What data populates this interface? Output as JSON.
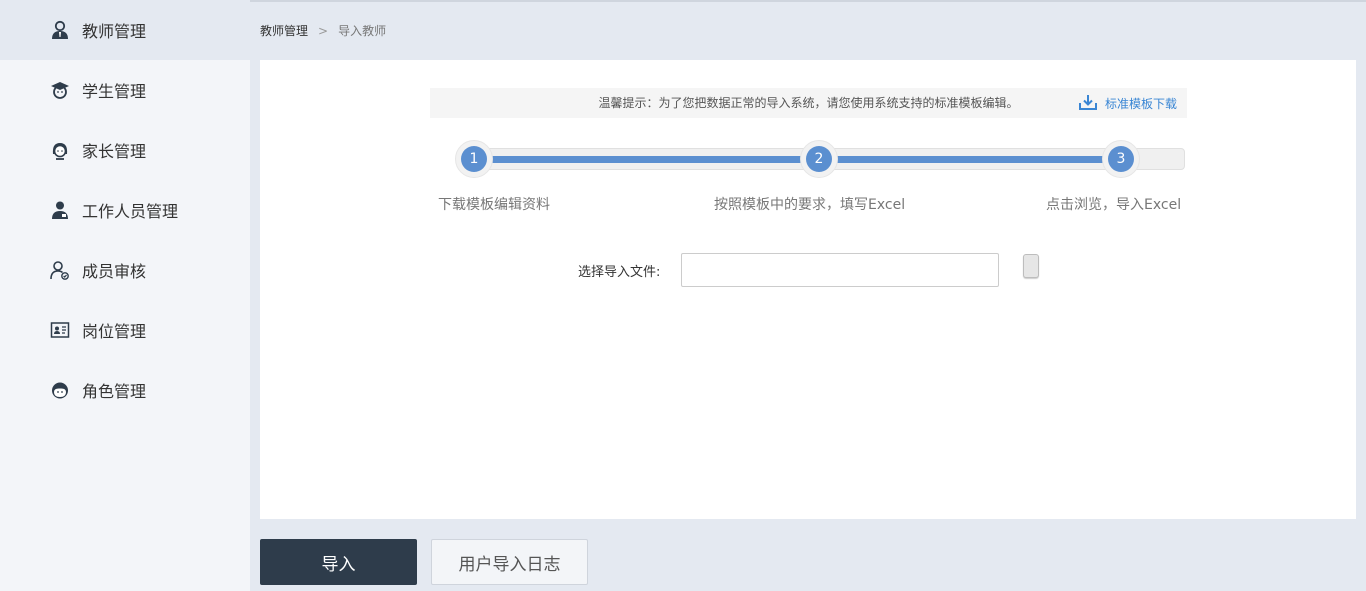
{
  "sidebar": {
    "items": [
      {
        "label": "教师管理",
        "icon": "teacher-icon",
        "active": true
      },
      {
        "label": "学生管理",
        "icon": "student-icon"
      },
      {
        "label": "家长管理",
        "icon": "parent-icon"
      },
      {
        "label": "工作人员管理",
        "icon": "staff-icon"
      },
      {
        "label": "成员审核",
        "icon": "member-review-icon"
      },
      {
        "label": "岗位管理",
        "icon": "position-icon"
      },
      {
        "label": "角色管理",
        "icon": "role-icon"
      }
    ]
  },
  "breadcrumb": {
    "root": "教师管理",
    "separator": ">",
    "current": "导入教师"
  },
  "tip": {
    "text": "温馨提示：为了您把数据正常的导入系统，请您使用系统支持的标准模板编辑。",
    "download_label": "标准模板下载"
  },
  "steps": [
    {
      "number": "1",
      "label": "下载模板编辑资料"
    },
    {
      "number": "2",
      "label": "按照模板中的要求，填写Excel"
    },
    {
      "number": "3",
      "label": "点击浏览，导入Excel"
    }
  ],
  "file": {
    "label": "选择导入文件:",
    "value": ""
  },
  "actions": {
    "import_label": "导入",
    "log_label": "用户导入日志"
  },
  "colors": {
    "accent": "#5b8fd0",
    "link": "#3a86d4",
    "primary_button": "#2e3c4b",
    "sidebar_bg": "#f3f5f9",
    "page_bg": "#e4e9f1"
  }
}
